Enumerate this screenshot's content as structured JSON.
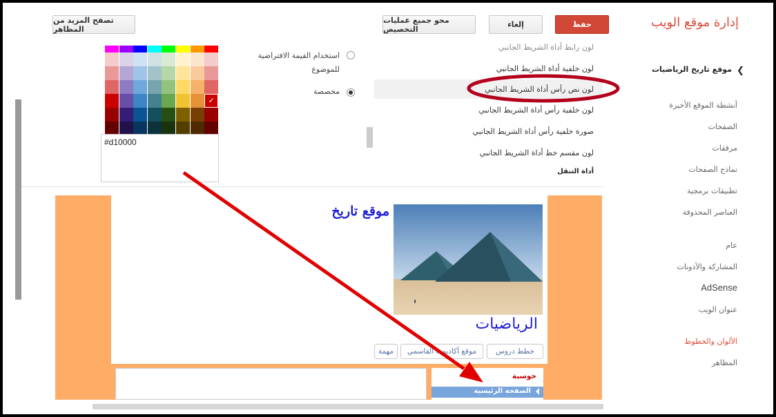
{
  "header": {
    "app_title": "إدارة موقع الويب",
    "save_label": "حفظ",
    "cancel_label": "إلغاء",
    "clear_label": "محو جميع عمليات التخصيص",
    "browse_themes_label": "تصفح المزيد من المظاهر"
  },
  "sidebar": {
    "site_name": "موقع تاريخ الرياضيات",
    "items": [
      "أنشطة الموقع الأخيرة",
      "الصفحات",
      "مرفقات",
      "نماذج الصفحات",
      "تطبيقات برمجية",
      "العناصر المحذوفة",
      "عام",
      "المشاركة والأذونات",
      "AdSense",
      "عنوان الويب",
      "الألوان والخطوط",
      "المظاهر"
    ],
    "active_item": "الألوان والخطوط"
  },
  "properties": {
    "partial_top": "لون رابط أداة الشريط الجانبي",
    "items": [
      "لون خلفية أداة الشريط الجانبي",
      "لون نص رأس أداة الشريط الجانبي",
      "لون خلفية رأس أداة الشريط الجانبي",
      "صورة خلفية رأس أداة الشريط الجانبي",
      "لون مقسم خط أداة الشريط الجانبي"
    ],
    "selected": "لون نص رأس أداة الشريط الجانبي",
    "section_next": "أداة التنقل"
  },
  "color_options": {
    "default_label": "استخدام القيمة الافتراضية للموضوع",
    "custom_label": "مخصصة",
    "selected": "custom",
    "hex_value": "#d10000"
  },
  "palette": {
    "columns": [
      [
        "#ff00ff",
        "#f4cccc",
        "#ea9999",
        "#e06666",
        "#cc0000",
        "#990000"
      ],
      [
        "#9900ff",
        "#d9d2e9",
        "#b4a7d6",
        "#8e7cc3",
        "#674ea7",
        "#351c75"
      ],
      [
        "#0000ff",
        "#cfe2f3",
        "#9fc5e8",
        "#6fa8dc",
        "#3d85c6",
        "#0b5394"
      ],
      [
        "#00ffff",
        "#d0e0e3",
        "#a2c4c9",
        "#76a5af",
        "#45818e",
        "#134f5c"
      ],
      [
        "#00ff00",
        "#d9ead3",
        "#b6d7a8",
        "#93c47d",
        "#6aa84f",
        "#274e13"
      ],
      [
        "#ffff00",
        "#fff2cc",
        "#ffe599",
        "#ffd966",
        "#f1c232",
        "#7f6000"
      ],
      [
        "#ff9900",
        "#fce5cd",
        "#f9cb9c",
        "#f6b26b",
        "#e69138",
        "#783f04"
      ],
      [
        "#ff0000",
        "#f4cccc",
        "#ea9999",
        "#e06666",
        "#cc0000",
        "#990000"
      ]
    ],
    "selected_color": "#cc0000"
  },
  "preview": {
    "site_title": "موقع تاريخ",
    "site_subtitle": "الرياضيات",
    "nav_tabs": [
      "خطط دروس",
      "موقع أكاديمية القاسمي",
      "مهمة"
    ],
    "sidebar_heading": "حوسبة",
    "sidebar_link": "الصفحة الرئيسية",
    "colors": {
      "background": "#ffad66",
      "title": "#1e1ed6",
      "heading": "#cc0000",
      "link_bar": "#78a6dc"
    }
  },
  "annotation": {
    "ellipse_color": "#b3001b",
    "arrow_color": "#e00000"
  }
}
